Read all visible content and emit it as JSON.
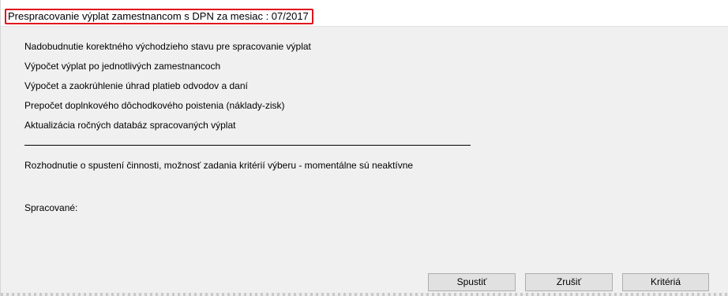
{
  "window": {
    "title": "Prespracovanie výplat zamestnancom s DPN za mesiac : 07/2017"
  },
  "steps": [
    "Nadobudnutie korektného východzieho stavu pre spracovanie výplat",
    "Výpočet výplat po jednotlivých zamestnancoch",
    "Výpočet a zaokrúhlenie úhrad platieb odvodov a daní",
    "Prepočet doplnkového dôchodkového poistenia (náklady-zisk)",
    "Aktualizácia ročných databáz spracovaných výplat"
  ],
  "decision_text": "Rozhodnutie o spustení činnosti, možnosť zadania kritérií výberu - momentálne sú neaktívne",
  "processed_label": "Spracované:",
  "buttons": {
    "start": "Spustiť",
    "cancel": "Zrušiť",
    "criteria": "Kritériá"
  },
  "colors": {
    "highlight_frame": "#e0141c",
    "dialog_background": "#f0f0f0",
    "button_face": "#e1e1e1"
  }
}
